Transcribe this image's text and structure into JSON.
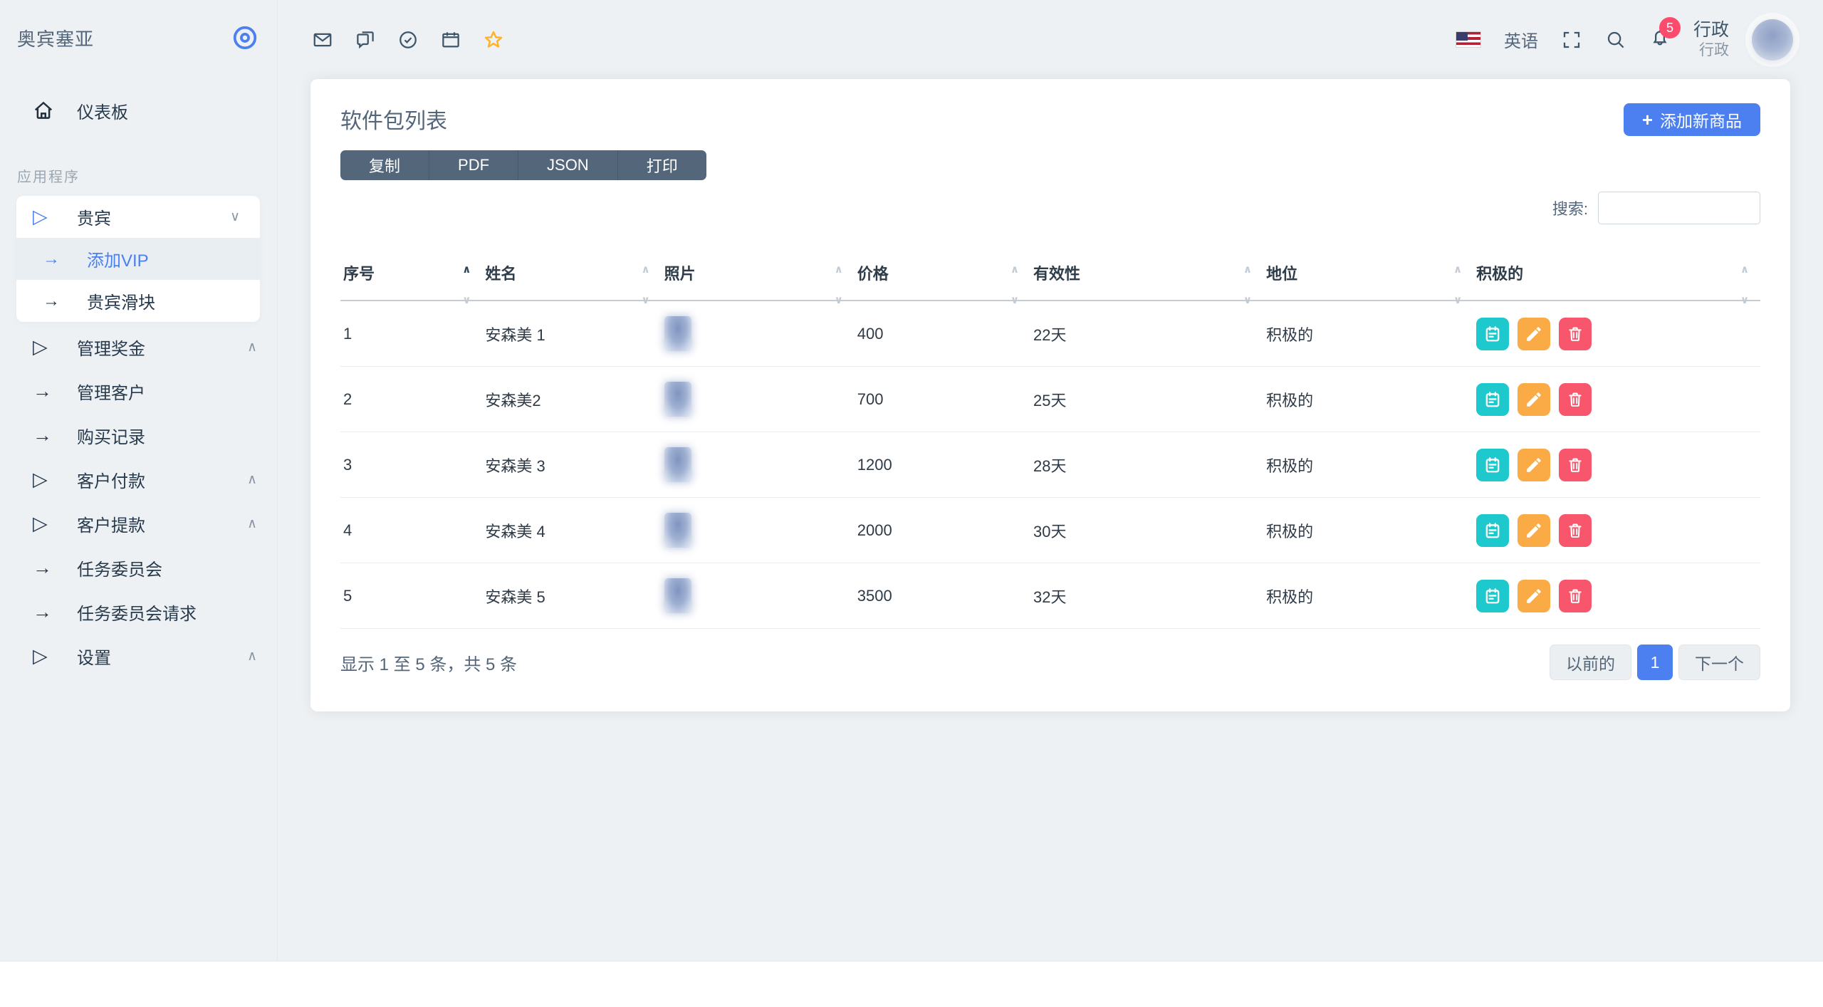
{
  "icons": {
    "arrow": "→",
    "triangle": "▷",
    "caret_up": "∧",
    "caret_down": "∨",
    "plus": "+"
  },
  "colors": {
    "accent": "#4c7ff0",
    "dark_button": "#54667a",
    "cyan": "#1dc9cd",
    "orange": "#fbab45",
    "red": "#f8566d",
    "badge": "#fc4b6c",
    "star": "#ffb22b"
  },
  "brand": {
    "name": "奥宾塞亚"
  },
  "sidebar": {
    "dashboard_label": "仪表板",
    "section_label": "应用程序",
    "vip": {
      "label": "贵宾"
    },
    "vip_children": [
      {
        "label": "添加VIP"
      },
      {
        "label": "贵宾滑块"
      }
    ],
    "items": [
      {
        "label": "管理奖金"
      },
      {
        "label": "管理客户"
      },
      {
        "label": "购买记录"
      },
      {
        "label": "客户付款"
      },
      {
        "label": "客户提款"
      },
      {
        "label": "任务委员会"
      },
      {
        "label": "任务委员会请求"
      },
      {
        "label": "设置"
      }
    ]
  },
  "topbar": {
    "language": "英语",
    "notification_count": "5",
    "user_name": "行政",
    "user_role": "行政"
  },
  "page": {
    "title": "软件包列表",
    "export_buttons": [
      {
        "label": "复制"
      },
      {
        "label": "PDF"
      },
      {
        "label": "JSON"
      },
      {
        "label": "打印"
      }
    ],
    "add_button": "添加新商品",
    "search_label": "搜索:"
  },
  "table": {
    "headers": [
      {
        "label": "序号"
      },
      {
        "label": "姓名"
      },
      {
        "label": "照片"
      },
      {
        "label": "价格"
      },
      {
        "label": "有效性"
      },
      {
        "label": "地位"
      },
      {
        "label": "积极的"
      }
    ],
    "rows": [
      {
        "sn": "1",
        "name": "安森美 1",
        "price": "400",
        "validity": "22天",
        "status": "积极的"
      },
      {
        "sn": "2",
        "name": "安森美2",
        "price": "700",
        "validity": "25天",
        "status": "积极的"
      },
      {
        "sn": "3",
        "name": "安森美 3",
        "price": "1200",
        "validity": "28天",
        "status": "积极的"
      },
      {
        "sn": "4",
        "name": "安森美 4",
        "price": "2000",
        "validity": "30天",
        "status": "积极的"
      },
      {
        "sn": "5",
        "name": "安森美 5",
        "price": "3500",
        "validity": "32天",
        "status": "积极的"
      }
    ],
    "info": "显示 1 至 5 条，共 5 条",
    "pagination": {
      "prev": "以前的",
      "current": "1",
      "next": "下一个"
    }
  }
}
